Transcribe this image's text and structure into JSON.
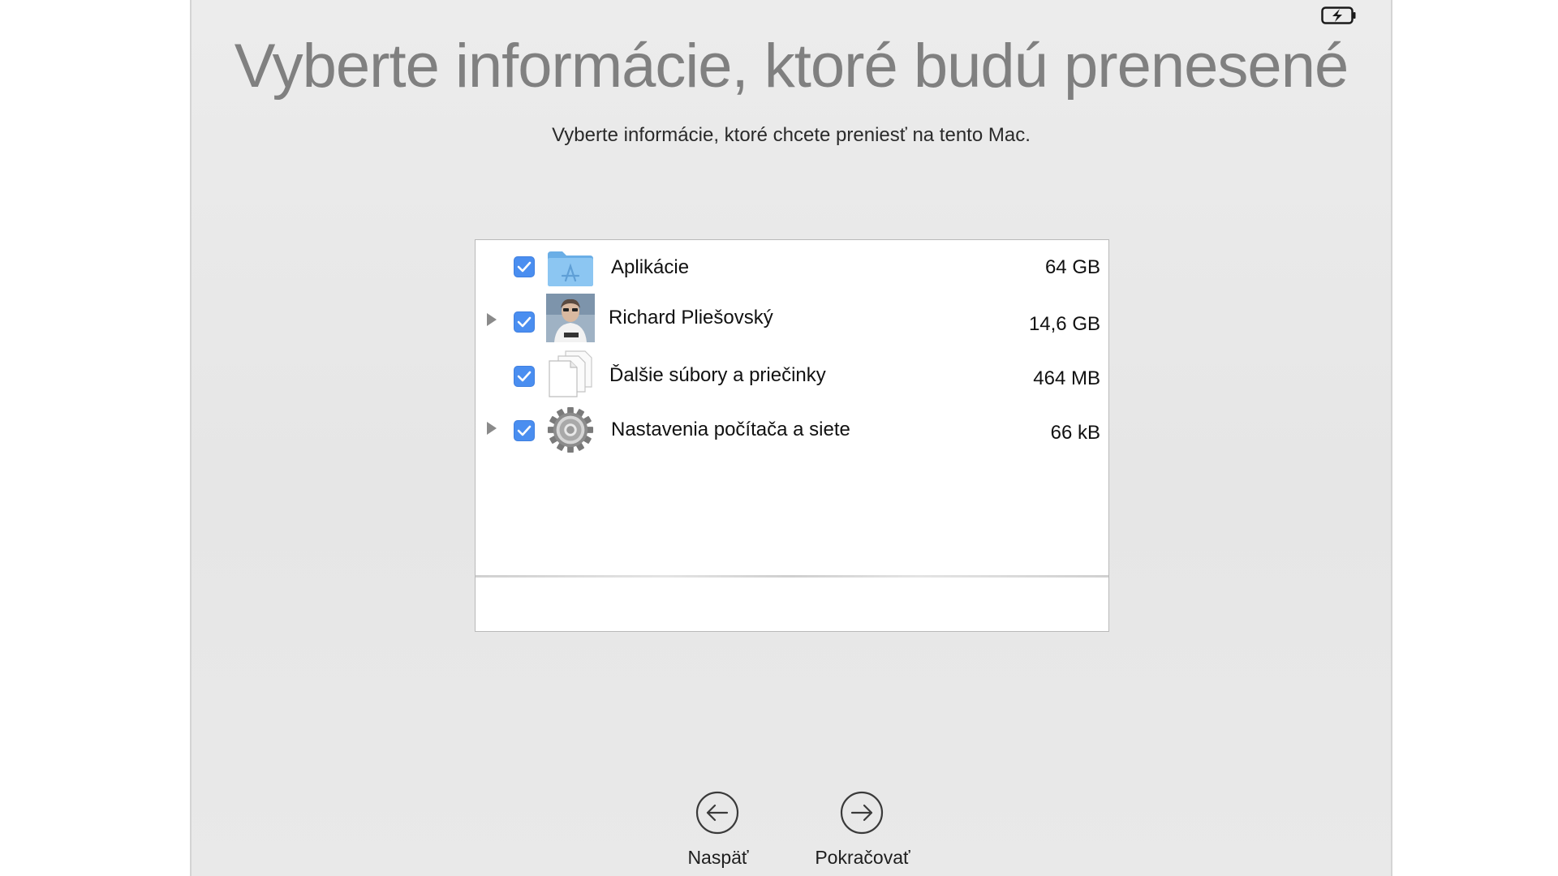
{
  "title": "Vyberte informácie, ktoré budú prenesené",
  "subtitle": "Vyberte informácie, ktoré chcete preniesť na tento Mac.",
  "items": [
    {
      "label": "Aplikácie",
      "size": "64 GB",
      "checked": true,
      "expandable": false,
      "icon": "applications-folder-icon"
    },
    {
      "label": "Richard Pliešovský",
      "size": "14,6 GB",
      "checked": true,
      "expandable": true,
      "icon": "user-avatar-icon"
    },
    {
      "label": "Ďalšie súbory a priečinky",
      "size": "464 MB",
      "checked": true,
      "expandable": false,
      "icon": "documents-icon"
    },
    {
      "label": "Nastavenia počítača a siete",
      "size": "66 kB",
      "checked": true,
      "expandable": true,
      "icon": "gear-icon"
    }
  ],
  "buttons": {
    "back_label": "Naspäť",
    "continue_label": "Pokračovať"
  },
  "status": {
    "battery_icon": "battery-charging-icon"
  },
  "colors": {
    "checkbox": "#4a8ef0",
    "title": "#808080",
    "folder": "#74b6ea"
  }
}
